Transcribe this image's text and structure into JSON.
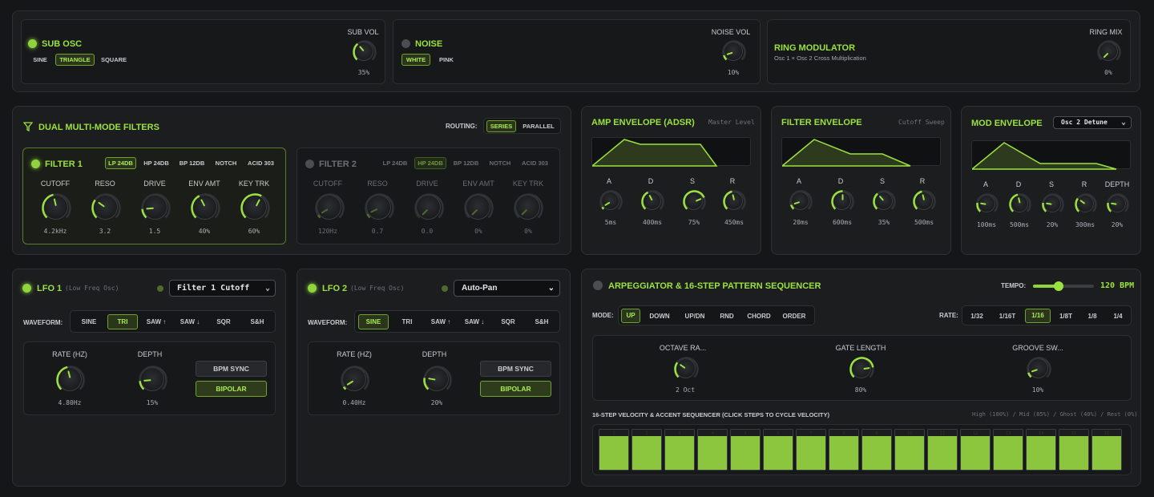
{
  "sub_osc": {
    "title": "SUB OSC",
    "waves": [
      "SINE",
      "TRIANGLE",
      "SQUARE"
    ],
    "active": 1,
    "vol_label": "SUB VOL",
    "vol_value": "35%",
    "vol": 0.35
  },
  "noise": {
    "title": "NOISE",
    "types": [
      "WHITE",
      "PINK"
    ],
    "active": 0,
    "vol_label": "NOISE VOL",
    "vol_value": "10%",
    "vol": 0.1
  },
  "ring": {
    "title": "RING MODULATOR",
    "subtitle": "Osc 1 × Osc 2 Cross Multiplication",
    "mix_label": "RING MIX",
    "mix_value": "0%",
    "mix": 0
  },
  "filters": {
    "title": "DUAL MULTI-MODE FILTERS",
    "routing_label": "ROUTING:",
    "routing": [
      "SERIES",
      "PARALLEL"
    ],
    "routing_active": 0,
    "modes": [
      "LP 24DB",
      "HP 24DB",
      "BP 12DB",
      "NOTCH",
      "ACID 303"
    ],
    "knob_labels": [
      "CUTOFF",
      "RESO",
      "DRIVE",
      "ENV AMT",
      "KEY TRK"
    ],
    "f1": {
      "title": "FILTER 1",
      "mode_active": 0,
      "values": [
        "4.2kHz",
        "3.2",
        "1.5",
        "40%",
        "60%"
      ],
      "levels": [
        0.45,
        0.3,
        0.15,
        0.4,
        0.6
      ]
    },
    "f2": {
      "title": "FILTER 2",
      "mode_active": 1,
      "values": [
        "120Hz",
        "0.7",
        "0.0",
        "0%",
        "0%"
      ],
      "levels": [
        0.05,
        0.07,
        0,
        0,
        0
      ]
    }
  },
  "amp_env": {
    "title": "AMP ENVELOPE (ADSR)",
    "note": "Master Level",
    "labels": [
      "A",
      "D",
      "S",
      "R"
    ],
    "values": [
      "5ms",
      "400ms",
      "75%",
      "450ms"
    ],
    "levels": [
      0.05,
      0.4,
      0.75,
      0.45
    ]
  },
  "filter_env": {
    "title": "FILTER ENVELOPE",
    "note": "Cutoff Sweep",
    "labels": [
      "A",
      "D",
      "S",
      "R"
    ],
    "values": [
      "20ms",
      "600ms",
      "35%",
      "500ms"
    ],
    "levels": [
      0.1,
      0.5,
      0.35,
      0.45
    ]
  },
  "mod_env": {
    "title": "MOD ENVELOPE",
    "target": "Osc 2 Detune",
    "labels": [
      "A",
      "D",
      "S",
      "R",
      "DEPTH"
    ],
    "values": [
      "100ms",
      "500ms",
      "20%",
      "300ms",
      "20%"
    ],
    "levels": [
      0.2,
      0.45,
      0.2,
      0.3,
      0.2
    ]
  },
  "lfo1": {
    "title": "LFO 1",
    "subtitle": "(Low Freq Osc)",
    "target": "Filter 1 Cutoff",
    "waveform_label": "WAVEFORM:",
    "waves": [
      "SINE",
      "TRI",
      "SAW ↑",
      "SAW ↓",
      "SQR",
      "S&H"
    ],
    "active": 1,
    "rate_label": "RATE (HZ)",
    "rate_value": "4.80Hz",
    "rate": 0.45,
    "depth_label": "DEPTH",
    "depth_value": "15%",
    "depth": 0.15,
    "bpm_sync": "BPM SYNC",
    "bipolar": "BIPOLAR"
  },
  "lfo2": {
    "title": "LFO 2",
    "subtitle": "(Low Freq Osc)",
    "target": "Auto-Pan",
    "waveform_label": "WAVEFORM:",
    "waves": [
      "SINE",
      "TRI",
      "SAW ↑",
      "SAW ↓",
      "SQR",
      "S&H"
    ],
    "active": 0,
    "rate_label": "RATE (HZ)",
    "rate_value": "0.40Hz",
    "rate": 0.05,
    "depth_label": "DEPTH",
    "depth_value": "20%",
    "depth": 0.2,
    "bpm_sync": "BPM SYNC",
    "bipolar": "BIPOLAR"
  },
  "arp": {
    "title": "ARPEGGIATOR & 16-STEP PATTERN SEQUENCER",
    "tempo_label": "TEMPO:",
    "tempo_value": "120 BPM",
    "tempo": 0.42,
    "mode_label": "MODE:",
    "modes": [
      "UP",
      "DOWN",
      "UP/DN",
      "RND",
      "CHORD",
      "ORDER"
    ],
    "mode_active": 0,
    "rate_label": "RATE:",
    "rates": [
      "1/32",
      "1/16T",
      "1/16",
      "1/8T",
      "1/8",
      "1/4"
    ],
    "rate_active": 2,
    "knobs": [
      {
        "label": "OCTAVE RA...",
        "value": "2 Oct",
        "level": 0.3
      },
      {
        "label": "GATE LENGTH",
        "value": "80%",
        "level": 0.8
      },
      {
        "label": "GROOVE SW...",
        "value": "10%",
        "level": 0.1
      }
    ],
    "seq_title": "16-STEP VELOCITY & ACCENT SEQUENCER (CLICK STEPS TO CYCLE VELOCITY)",
    "seq_legend": "High (100%) / Mid (85%) / Ghost (40%) / Rest (0%)",
    "steps": [
      "1",
      "2",
      "3",
      "4",
      "5",
      "6",
      "7",
      "8",
      "9",
      "10",
      "11",
      "12",
      "13",
      "14",
      "15",
      "16"
    ],
    "velocities": [
      0.85,
      0.85,
      0.85,
      0.85,
      0.85,
      0.85,
      0.85,
      0.85,
      0.85,
      0.85,
      0.85,
      0.85,
      0.85,
      0.85,
      0.85,
      0.85
    ]
  },
  "colors": {
    "accent": "#9be23f",
    "panel": "#1c1d1f"
  }
}
